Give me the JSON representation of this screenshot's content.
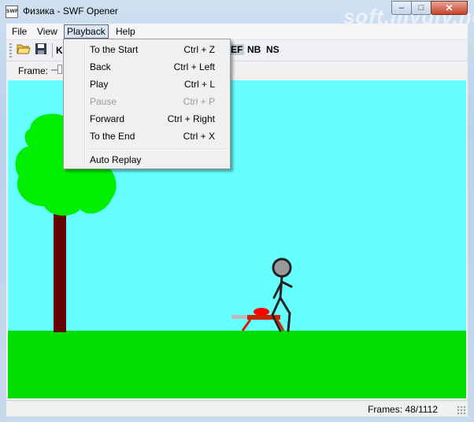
{
  "window": {
    "title": "Физика - SWF Opener",
    "app_icon": "swf-file-icon",
    "watermark": "soft.mydiv.net",
    "controls": {
      "minimize": "–",
      "maximize": "□",
      "close": "✕"
    }
  },
  "menubar": {
    "file": "File",
    "view": "View",
    "playback": "Playback",
    "help": "Help"
  },
  "toolbar": {
    "open_icon": "open-folder-icon",
    "save_icon": "save-disk-icon",
    "k": "K",
    "ef": "EF",
    "nb": "NB",
    "ns": "NS"
  },
  "framebar": {
    "label": "Frame:"
  },
  "playback_menu": {
    "items": [
      {
        "label": "To the Start",
        "shortcut": "Ctrl + Z",
        "enabled": true
      },
      {
        "label": "Back",
        "shortcut": "Ctrl + Left",
        "enabled": true
      },
      {
        "label": "Play",
        "shortcut": "Ctrl + L",
        "enabled": true
      },
      {
        "label": "Pause",
        "shortcut": "Ctrl + P",
        "enabled": false
      },
      {
        "label": "Forward",
        "shortcut": "Ctrl + Right",
        "enabled": true
      },
      {
        "label": "To the End",
        "shortcut": "Ctrl + X",
        "enabled": true
      }
    ],
    "auto_replay": "Auto Replay"
  },
  "status": {
    "frames": "Frames: 48/1112"
  },
  "colors": {
    "sky": "#66ffff",
    "grass": "#00dd00",
    "tree_crown": "#00ee00",
    "trunk": "#660000",
    "figure_head": "#999999",
    "bench": "#cc2200"
  }
}
